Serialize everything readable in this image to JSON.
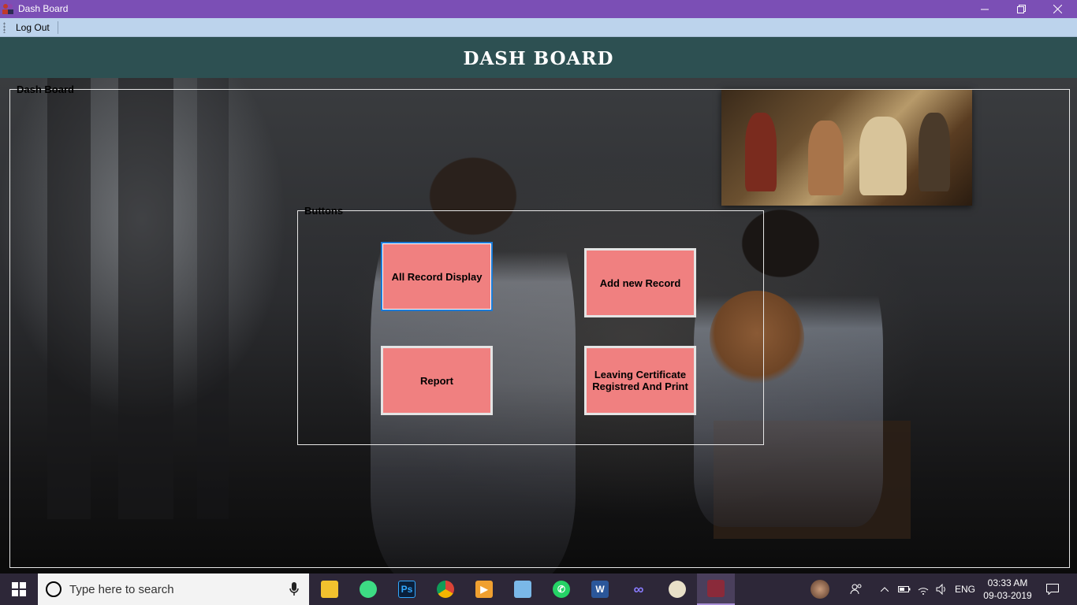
{
  "window": {
    "title": "Dash Board",
    "app_icon": "people-icon"
  },
  "menu": {
    "logout_label": "Log Out"
  },
  "header": {
    "title": "DASH BOARD"
  },
  "groups": {
    "dashboard_label": "Dash Board",
    "buttons_label": "Buttons"
  },
  "buttons": {
    "all_records": "All Record Display",
    "add_record": "Add new Record",
    "report": "Report",
    "leaving_certificate": "Leaving Certificate Registred And Print"
  },
  "taskbar": {
    "search_placeholder": "Type here to search",
    "apps": [
      "file-explorer-icon",
      "android-studio-icon",
      "photoshop-icon",
      "chrome-icon",
      "media-player-icon",
      "3d-box-icon",
      "whatsapp-icon",
      "word-icon",
      "infinity-app-icon",
      "paint-icon",
      "dashboard-app-icon"
    ],
    "language": "ENG",
    "time": "03:33 AM",
    "date": "09-03-2019"
  },
  "colors": {
    "titlebar": "#7b4fb5",
    "menubar": "#bcd3ec",
    "header": "#2d5052",
    "button_fill": "#f08080",
    "focus_border": "#1c7ad6",
    "taskbar": "#2d2738"
  }
}
